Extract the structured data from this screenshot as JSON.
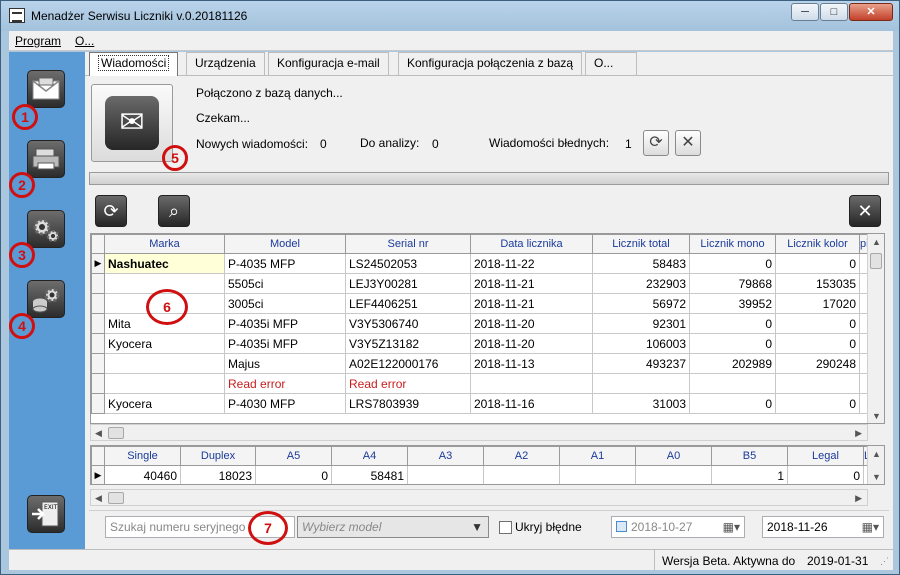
{
  "window": {
    "title": "Menadżer Serwisu Liczniki v.0.20181126",
    "minimize": "─",
    "maximize": "□",
    "close": "✕"
  },
  "menu": [
    "Program",
    "O..."
  ],
  "sidebar": {
    "items": [
      {
        "icon": "mail-envelope-icon",
        "badge": "1"
      },
      {
        "icon": "printer-icon",
        "badge": "2"
      },
      {
        "icon": "gears-icon",
        "badge": "3"
      },
      {
        "icon": "database-gear-icon",
        "badge": "4"
      }
    ],
    "exit_label": "EXIT"
  },
  "tabs": [
    "Wiadomości",
    "Urządzenia",
    "Konfiguracja e-mail",
    "Konfiguracja połączenia z bazą",
    "O..."
  ],
  "messages": {
    "status_db": "Połączono z bazą danych...",
    "status_wait": "Czekam...",
    "new_label": "Nowych wiadomości:",
    "new_value": "0",
    "analysis_label": "Do analizy:",
    "analysis_value": "0",
    "errors_label": "Wiadomości błednych:",
    "errors_value": "1",
    "badge": "5"
  },
  "grid": {
    "columns": [
      "Marka",
      "Model",
      "Serial nr",
      "Data licznika",
      "Licznik total",
      "Licznik mono",
      "Licznik kolor",
      "pian"
    ],
    "badge": "6",
    "rows": [
      {
        "marka": "Nashuatec",
        "model": "P-4035 MFP",
        "serial": "LS24502053",
        "date": "2018-11-22",
        "total": "58483",
        "mono": "0",
        "kolor": "0",
        "current": true
      },
      {
        "marka": "",
        "model": "5505ci",
        "serial": "LEJ3Y00281",
        "date": "2018-11-21",
        "total": "232903",
        "mono": "79868",
        "kolor": "153035"
      },
      {
        "marka": "",
        "model": "3005ci",
        "serial": "LEF4406251",
        "date": "2018-11-21",
        "total": "56972",
        "mono": "39952",
        "kolor": "17020"
      },
      {
        "marka": "Mita",
        "model": "P-4035i MFP",
        "serial": "V3Y5306740",
        "date": "2018-11-20",
        "total": "92301",
        "mono": "0",
        "kolor": "0"
      },
      {
        "marka": "Kyocera",
        "model": "P-4035i MFP",
        "serial": "V3Y5Z13182",
        "date": "2018-11-20",
        "total": "106003",
        "mono": "0",
        "kolor": "0"
      },
      {
        "marka": "",
        "model": "Majus",
        "serial": "A02E122000176",
        "date": "2018-11-13",
        "total": "493237",
        "mono": "202989",
        "kolor": "290248"
      },
      {
        "marka": "",
        "model": "Read error",
        "serial": "Read error",
        "date": "",
        "total": "",
        "mono": "",
        "kolor": "",
        "error": true
      },
      {
        "marka": "Kyocera",
        "model": "P-4030 MFP",
        "serial": "LRS7803939",
        "date": "2018-11-16",
        "total": "31003",
        "mono": "0",
        "kolor": "0"
      }
    ]
  },
  "grid2": {
    "columns": [
      "Single",
      "Duplex",
      "A5",
      "A4",
      "A3",
      "A2",
      "A1",
      "A0",
      "B5",
      "Legal",
      "L"
    ],
    "row": [
      "40460",
      "18023",
      "0",
      "58481",
      "",
      "",
      "",
      "",
      "1",
      "0",
      ""
    ]
  },
  "filter": {
    "search_placeholder": "Szukaj numeru seryjnego",
    "model_placeholder": "Wybierz model",
    "hide_errors_label": "Ukryj błędne",
    "date_from": "2018-10-27",
    "date_to": "2018-11-26",
    "badge": "7"
  },
  "status": {
    "version_text": "Wersja Beta. Aktywna do",
    "date": "2019-01-31"
  },
  "colors": {
    "sidebar": "#5b9bd5",
    "error": "#c81e1e",
    "header_text": "#1a3a9a",
    "badge": "#d01010"
  }
}
